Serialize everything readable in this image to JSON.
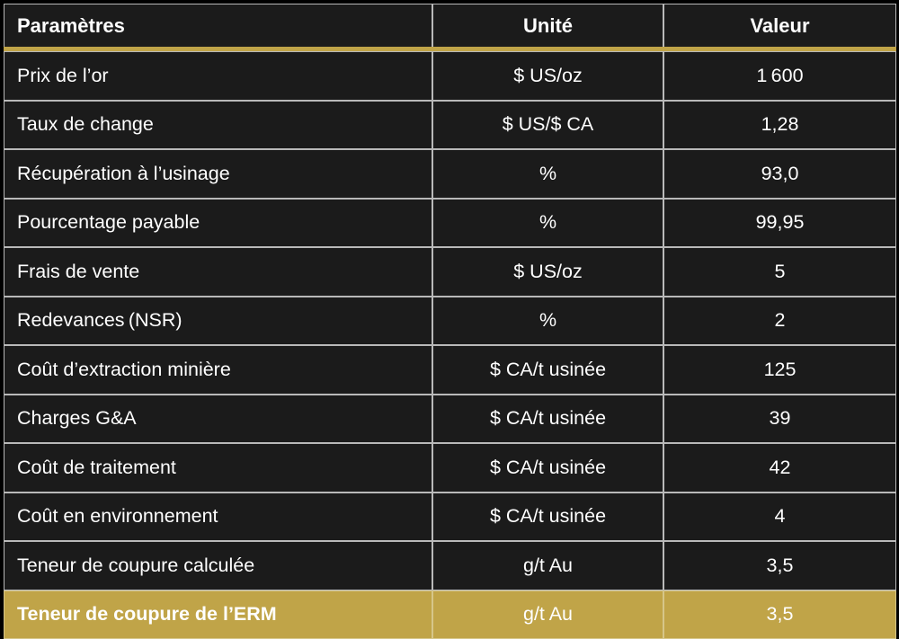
{
  "table": {
    "columns": [
      {
        "key": "parametre",
        "label": "Paramètres",
        "align": "left"
      },
      {
        "key": "unite",
        "label": "Unité",
        "align": "center"
      },
      {
        "key": "valeur",
        "label": "Valeur",
        "align": "center"
      }
    ],
    "accent_color": "#c0a448",
    "background_color": "#1b1b1b",
    "border_color": "#b9b9b9",
    "text_color": "#ffffff",
    "rows": [
      {
        "parametre": "Prix de l’or",
        "unite": "$ US/oz",
        "valeur": "1 600",
        "highlight": false
      },
      {
        "parametre": "Taux de change",
        "unite": "$ US/$ CA",
        "valeur": "1,28",
        "highlight": false
      },
      {
        "parametre": "Récupération à l’usinage",
        "unite": "%",
        "valeur": "93,0",
        "highlight": false
      },
      {
        "parametre": "Pourcentage payable",
        "unite": "%",
        "valeur": "99,95",
        "highlight": false
      },
      {
        "parametre": "Frais de vente",
        "unite": "$ US/oz",
        "valeur": "5",
        "highlight": false
      },
      {
        "parametre": "Redevances (NSR)",
        "unite": "%",
        "valeur": "2",
        "highlight": false
      },
      {
        "parametre": "Coût d’extraction minière",
        "unite": "$ CA/t usinée",
        "valeur": "125",
        "highlight": false
      },
      {
        "parametre": "Charges G&A",
        "unite": "$ CA/t usinée",
        "valeur": "39",
        "highlight": false
      },
      {
        "parametre": "Coût de traitement",
        "unite": "$ CA/t usinée",
        "valeur": "42",
        "highlight": false
      },
      {
        "parametre": "Coût en environnement",
        "unite": "$ CA/t usinée",
        "valeur": "4",
        "highlight": false
      },
      {
        "parametre": "Teneur de coupure calculée",
        "unite": "g/t Au",
        "valeur": "3,5",
        "highlight": false
      },
      {
        "parametre": "Teneur de coupure de l’ERM",
        "unite": "g/t Au",
        "valeur": "3,5",
        "highlight": true
      }
    ]
  }
}
